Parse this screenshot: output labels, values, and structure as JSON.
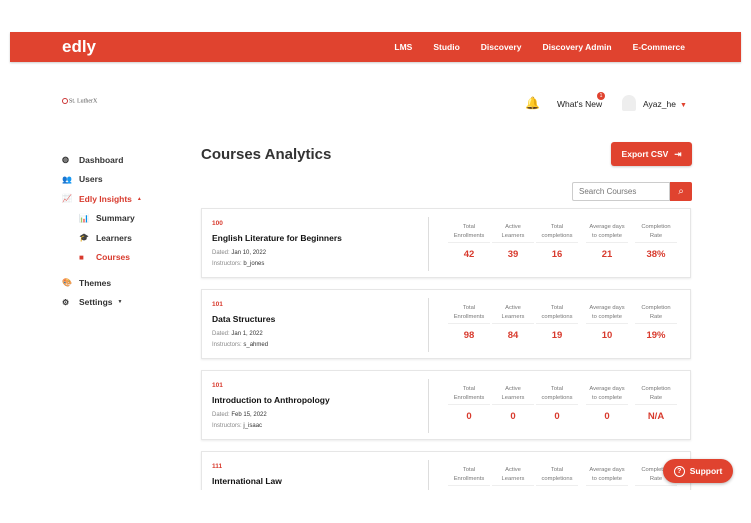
{
  "header": {
    "logo": "edly",
    "nav": [
      "LMS",
      "Studio",
      "Discovery",
      "Discovery Admin",
      "E-Commerce"
    ]
  },
  "subheader": {
    "school": "St. LutherX",
    "whats_new": "What's New",
    "badge_count": "1",
    "username": "Ayaz_he"
  },
  "sidebar": {
    "items": [
      {
        "label": "Dashboard",
        "icon": "dashboard-icon",
        "active": false,
        "sub": false
      },
      {
        "label": "Users",
        "icon": "users-icon",
        "active": false,
        "sub": false
      },
      {
        "label": "Edly Insights",
        "icon": "chart-icon",
        "active": true,
        "sub": false,
        "caret": "▲"
      },
      {
        "label": "Summary",
        "icon": "bar-chart-icon",
        "active": false,
        "sub": true
      },
      {
        "label": "Learners",
        "icon": "graduation-cap-icon",
        "active": false,
        "sub": true
      },
      {
        "label": "Courses",
        "icon": "book-icon",
        "active": true,
        "sub": true
      },
      {
        "label": "Themes",
        "icon": "palette-icon",
        "active": false,
        "sub": false
      },
      {
        "label": "Settings",
        "icon": "gear-icon",
        "active": false,
        "sub": false,
        "caret": "▼"
      }
    ]
  },
  "page": {
    "title": "Courses Analytics",
    "export_label": "Export CSV",
    "search_placeholder": "Search Courses",
    "support_label": "Support"
  },
  "stat_labels": [
    [
      "Total",
      "Enrollments"
    ],
    [
      "Active",
      "Learners"
    ],
    [
      "Total",
      "completions"
    ],
    [
      "Average days",
      "to complete"
    ],
    [
      "Completion",
      "Rate"
    ]
  ],
  "courses": [
    {
      "code": "100",
      "name": "English Literature for Beginners",
      "dated_label": "Dated:",
      "dated": "Jan 10, 2022",
      "instructors_label": "Instructors:",
      "instructors": "b_jones",
      "values": [
        "42",
        "39",
        "16",
        "21",
        "38%"
      ]
    },
    {
      "code": "101",
      "name": "Data Structures",
      "dated_label": "Dated:",
      "dated": "Jan 1, 2022",
      "instructors_label": "Instructors:",
      "instructors": "s_ahmed",
      "values": [
        "98",
        "84",
        "19",
        "10",
        "19%"
      ]
    },
    {
      "code": "101",
      "name": "Introduction to Anthropology",
      "dated_label": "Dated:",
      "dated": "Feb 15, 2022",
      "instructors_label": "Instructors:",
      "instructors": "j_isaac",
      "values": [
        "0",
        "0",
        "0",
        "0",
        "N/A"
      ]
    },
    {
      "code": "111",
      "name": "International Law",
      "values": []
    }
  ],
  "colors": {
    "brand": "#e0432f",
    "accent_text": "#d83a2d"
  }
}
